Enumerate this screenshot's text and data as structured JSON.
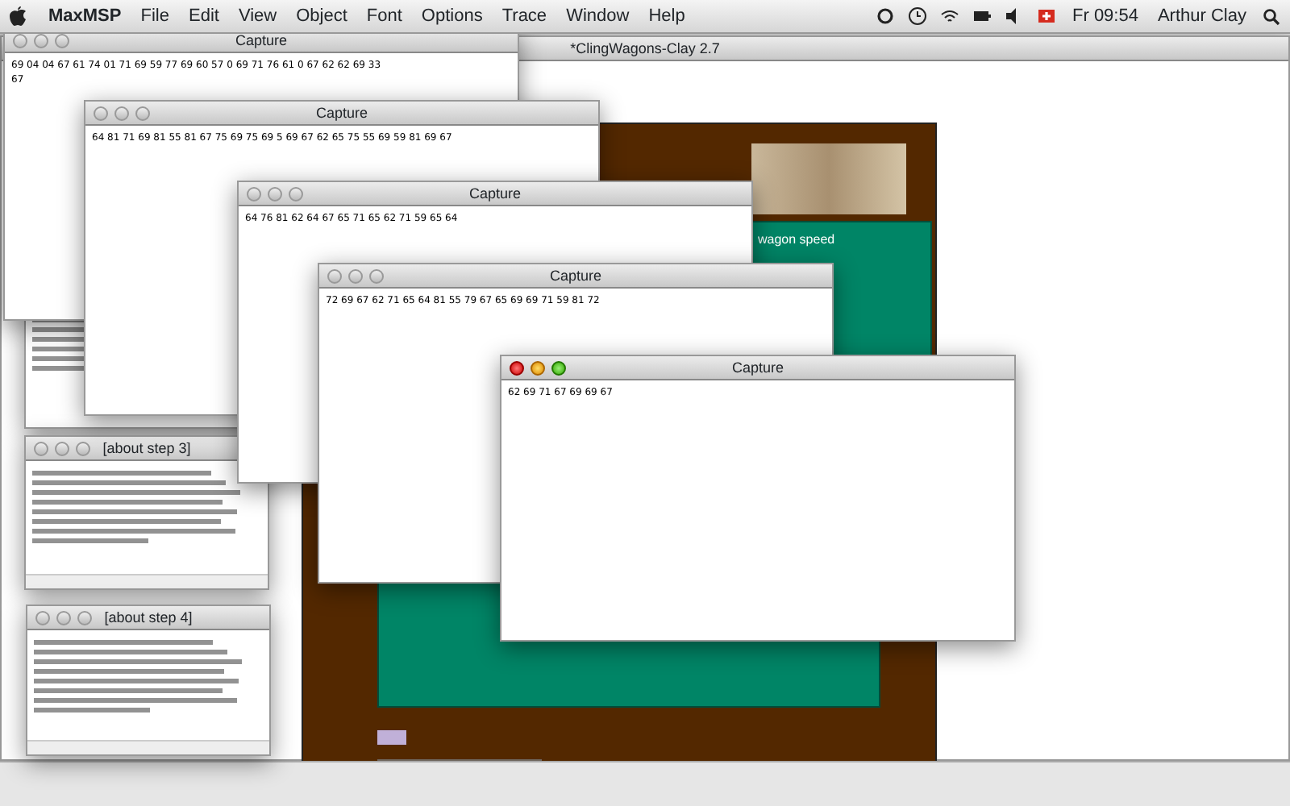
{
  "menu_bar": {
    "app": "MaxMSP",
    "menus": [
      "File",
      "Edit",
      "View",
      "Object",
      "Font",
      "Options",
      "Trace",
      "Window",
      "Help"
    ],
    "clock": "Fr 09:54",
    "user": "Arthur Clay"
  },
  "main_window": {
    "title": "*ClingWagons-Clay 2.7",
    "panel_label": "wagon speed"
  },
  "capture_windows": [
    {
      "title": "Capture",
      "text": "69 04 04 67 61 74 01 71 69 59 77 69 60 57 0 69 71 76 61 0 67 62 62 69 33\n67",
      "active": false
    },
    {
      "title": "Capture",
      "text": "64 81 71 69 81 55 81 67 75 69 75 69 5 69 67 62 65 75 55 69 59 81 69 67",
      "active": false
    },
    {
      "title": "Capture",
      "text": "64 76 81 62 64 67 65 71 65 62 71 59 65 64",
      "active": false
    },
    {
      "title": "Capture",
      "text": "72 69 67 62 71 65 64 81 55 79 67 65 69 69 71 59 81 72",
      "active": false
    },
    {
      "title": "Capture",
      "text": "62 69 71 67 69 69 67",
      "active": true
    }
  ],
  "about_windows": [
    {
      "title": "[about step 3]"
    },
    {
      "title": "[about step 4]"
    }
  ]
}
